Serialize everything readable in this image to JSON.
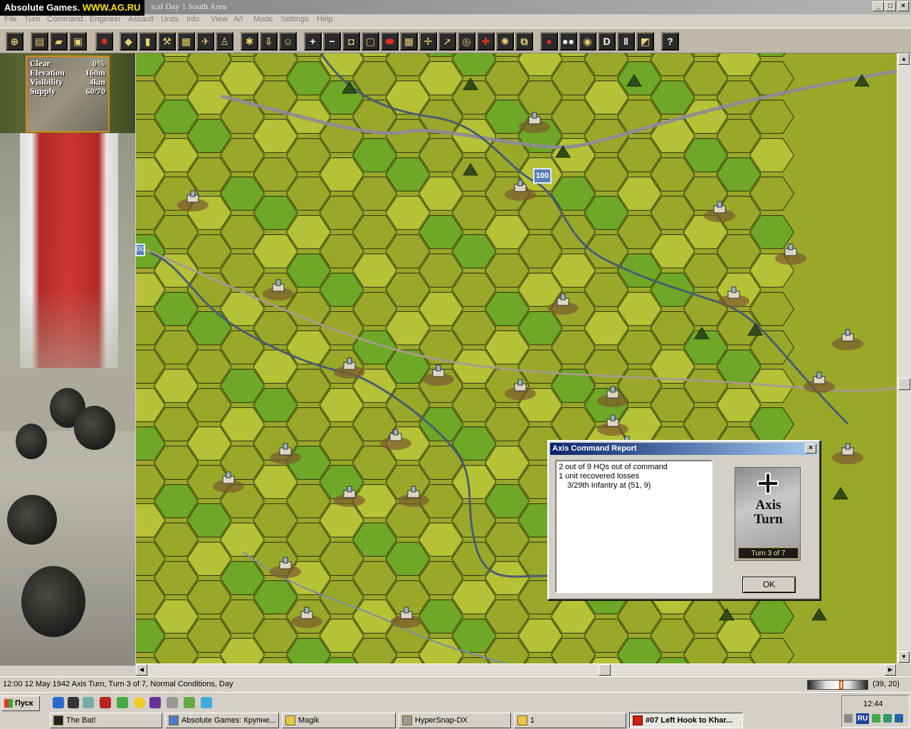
{
  "window": {
    "overlay_brand": "Absolute Games.",
    "overlay_url": "WWW.AG.RU",
    "title": "ical Day 1 South Area",
    "controls": [
      "_",
      "□",
      "×"
    ]
  },
  "menu": [
    "File",
    "Turn",
    "Command",
    "Engineer",
    "Assault",
    "Units",
    "Info",
    "View",
    "A/I",
    "Mode",
    "Settings",
    "Help"
  ],
  "toolbar": {
    "buttons": [
      {
        "name": "target-icon",
        "glyph": "⊕"
      },
      {
        "name": "scroll-icon",
        "glyph": "▤"
      },
      {
        "name": "open-folder-icon",
        "glyph": "▰"
      },
      {
        "name": "save-disk-icon",
        "glyph": "▣"
      },
      {
        "name": "explosion-icon",
        "glyph": "✸"
      },
      {
        "name": "tank-icon",
        "glyph": "◆"
      },
      {
        "name": "ammo-icon",
        "glyph": "▮"
      },
      {
        "name": "shovel-icon",
        "glyph": "⚒"
      },
      {
        "name": "crate-icon",
        "glyph": "▦"
      },
      {
        "name": "plane-icon",
        "glyph": "✈"
      },
      {
        "name": "person-icon",
        "glyph": "♙"
      },
      {
        "name": "flag-icon",
        "glyph": "✱"
      },
      {
        "name": "arrow-down-icon",
        "glyph": "⇩"
      },
      {
        "name": "portrait-icon",
        "glyph": "☺"
      },
      {
        "name": "zoom-in-icon",
        "glyph": "+"
      },
      {
        "name": "zoom-out-icon",
        "glyph": "−"
      },
      {
        "name": "hex-toggle-icon",
        "glyph": "◘"
      },
      {
        "name": "counter-icon",
        "glyph": "▢"
      },
      {
        "name": "red-ellipse-icon",
        "glyph": "⬬"
      },
      {
        "name": "grid-icon",
        "glyph": "▦"
      },
      {
        "name": "crosshair-icon",
        "glyph": "✛"
      },
      {
        "name": "arrow-icon",
        "glyph": "➚"
      },
      {
        "name": "ring-icon",
        "glyph": "◎"
      },
      {
        "name": "cross-icon",
        "glyph": "✚"
      },
      {
        "name": "burst-icon",
        "glyph": "✺"
      },
      {
        "name": "link-icon",
        "glyph": "⧉"
      },
      {
        "name": "red-dot-icon",
        "glyph": "●"
      },
      {
        "name": "dots-icon",
        "glyph": "●●"
      },
      {
        "name": "target-rings-icon",
        "glyph": "◉"
      },
      {
        "name": "d-letter-icon",
        "glyph": "D"
      },
      {
        "name": "bars-icon",
        "glyph": "‖"
      },
      {
        "name": "flag-split-icon",
        "glyph": "◩"
      },
      {
        "name": "help-icon",
        "glyph": "?"
      }
    ]
  },
  "terrain_info": {
    "rows": [
      {
        "label": "Clear",
        "value": "0%"
      },
      {
        "label": "Elevation",
        "value": "160m"
      },
      {
        "label": "Visibility",
        "value": "4km"
      },
      {
        "label": "Supply",
        "value": "60/70"
      }
    ]
  },
  "map": {
    "hq_label": "100",
    "hq_label_2": "00"
  },
  "dialog": {
    "title": "Axis Command Report",
    "close": "×",
    "lines": [
      "2 out of 9 HQs out of command",
      "1 unit recovered losses"
    ],
    "detail": "3/29th Infantry at (51, 9)",
    "card_word1": "Axis",
    "card_word2": "Turn",
    "card_counter": "Turn  3  of  7",
    "ok": "OK"
  },
  "status": {
    "text": "12:00 12 May 1942 Axis Turn, Turn 3 of 7, Normal Conditions, Day",
    "coords": "(39, 20)"
  },
  "taskbar": {
    "start": "Пуск",
    "tasks": [
      {
        "label": "The Bat!",
        "active": false
      },
      {
        "label": "Absolute Games: Крупне...",
        "active": false
      },
      {
        "label": "Magik",
        "active": false
      },
      {
        "label": "HyperSnap-DX",
        "active": false
      },
      {
        "label": "1",
        "active": false
      },
      {
        "label": "#07 Left Hook to Khar...",
        "active": true
      }
    ],
    "clock": "12:44",
    "lang": "RU"
  },
  "colors": {
    "grass": "#9aa82a",
    "grass_light": "#b6c236",
    "hex_line": "#2c3010",
    "river": "#4b5d6e",
    "road": "#8e8a96",
    "dialog_title": "#0a246a"
  }
}
